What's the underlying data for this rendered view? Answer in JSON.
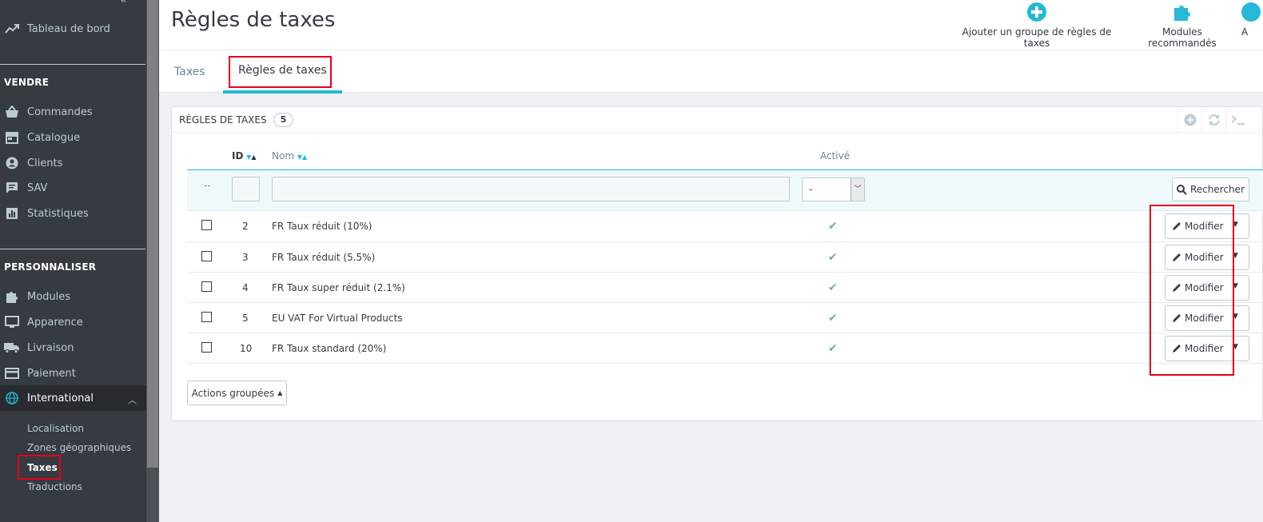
{
  "sidebar": {
    "dashboard": "Tableau de bord",
    "section_sell": "VENDRE",
    "sell_items": [
      "Commandes",
      "Catalogue",
      "Clients",
      "SAV",
      "Statistiques"
    ],
    "section_customize": "PERSONNALISER",
    "customize_items": [
      "Modules",
      "Apparence",
      "Livraison",
      "Paiement",
      "International"
    ],
    "international_sub": [
      "Localisation",
      "Zones géographiques",
      "Taxes",
      "Traductions"
    ]
  },
  "header": {
    "title": "Règles de taxes",
    "toolbar": {
      "add_group": "Ajouter un groupe de règles de taxes",
      "recommended": "Modules recommandés",
      "help": "A"
    },
    "tabs": [
      "Taxes",
      "Règles de taxes"
    ]
  },
  "panel": {
    "heading": "Règles de taxes",
    "count": "5",
    "columns": {
      "id": "ID",
      "name": "Nom",
      "active": "Activé"
    },
    "filter": {
      "dash": "--",
      "select_value": "-",
      "search_label": "Rechercher"
    },
    "rows": [
      {
        "id": "2",
        "name": "FR Taux réduit (10%)",
        "edit": "Modifier"
      },
      {
        "id": "3",
        "name": "FR Taux réduit (5.5%)",
        "edit": "Modifier"
      },
      {
        "id": "4",
        "name": "FR Taux super réduit (2.1%)",
        "edit": "Modifier"
      },
      {
        "id": "5",
        "name": "EU VAT For Virtual Products",
        "edit": "Modifier"
      },
      {
        "id": "10",
        "name": "FR Taux standard (20%)",
        "edit": "Modifier"
      }
    ],
    "bulk_actions": "Actions groupées"
  },
  "colors": {
    "accent": "#25b9d7",
    "sidebar": "#363a41",
    "highlight": "#e3001b",
    "check": "#70b580"
  }
}
